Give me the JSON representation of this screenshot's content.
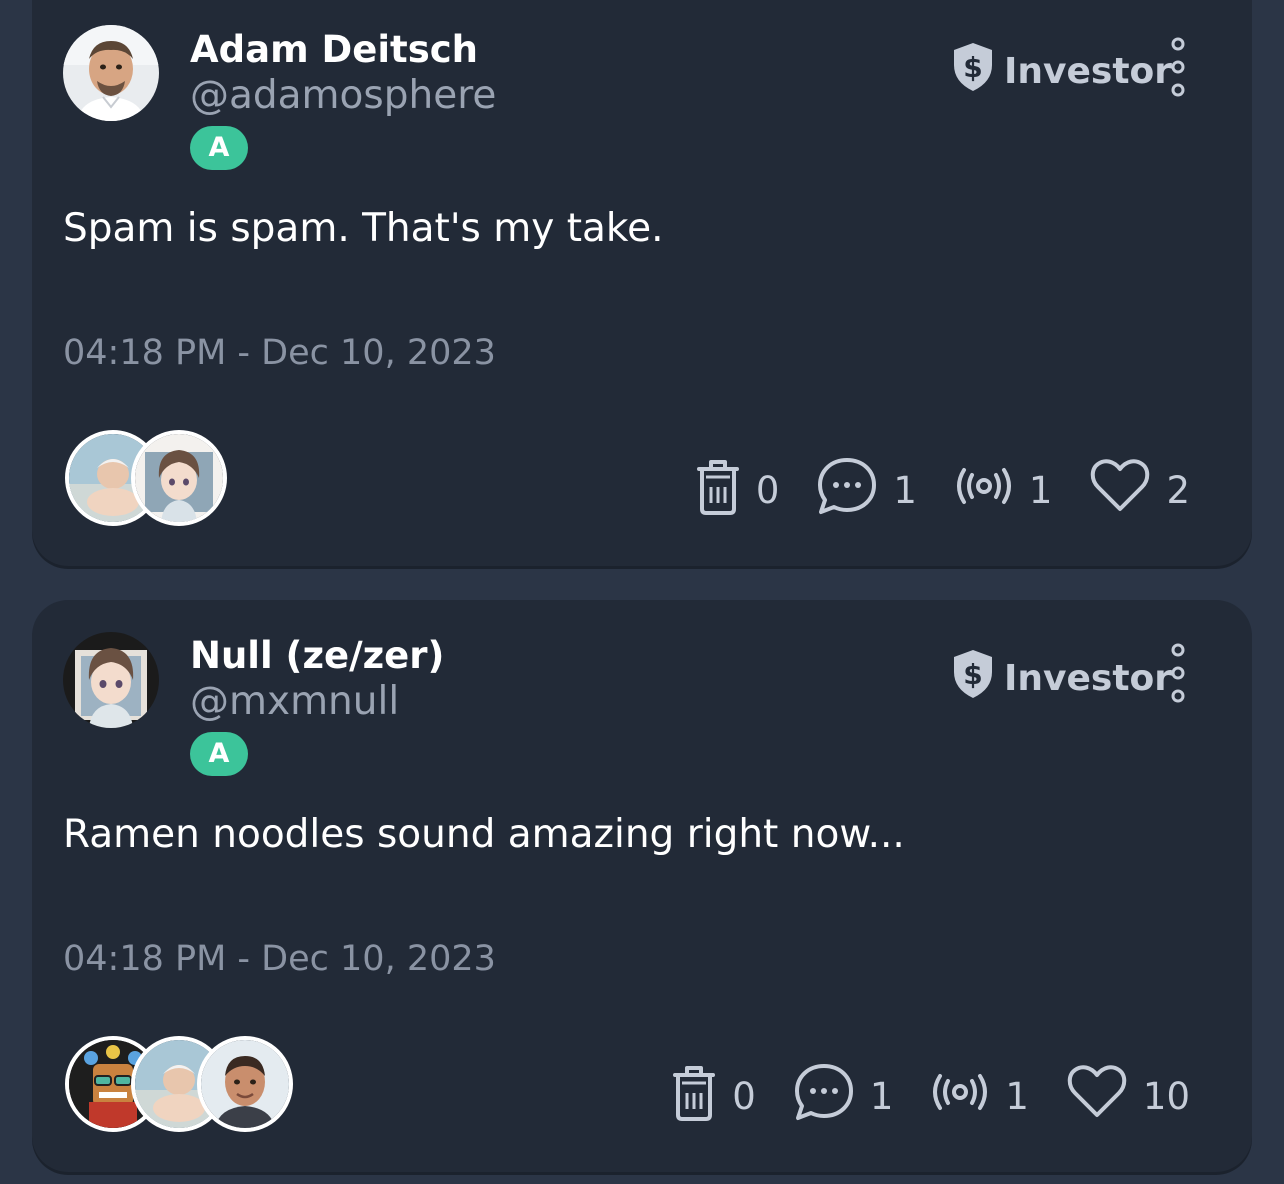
{
  "colors": {
    "background": "#2b3546",
    "card": "#222a37",
    "badge": "#3cc49a",
    "muted_text": "#8a93a3",
    "icon": "#c5ccd8"
  },
  "posts": [
    {
      "author_name": "Adam Deitsch",
      "handle": "@adamosphere",
      "badge": "A",
      "role_label": "Investor",
      "role_icon": "dollar-shield-icon",
      "text": "Spam is spam. That's my take.",
      "timestamp": "04:18 PM - Dec 10, 2023",
      "counts": {
        "delete": "0",
        "comments": "1",
        "broadcasts": "1",
        "likes": "2"
      }
    },
    {
      "author_name": "Null (ze/zer)",
      "handle": "@mxmnull",
      "badge": "A",
      "role_label": "Investor",
      "role_icon": "dollar-shield-icon",
      "text": "Ramen noodles sound amazing right now...",
      "timestamp": "04:18 PM - Dec 10, 2023",
      "counts": {
        "delete": "0",
        "comments": "1",
        "broadcasts": "1",
        "likes": "10"
      }
    }
  ]
}
